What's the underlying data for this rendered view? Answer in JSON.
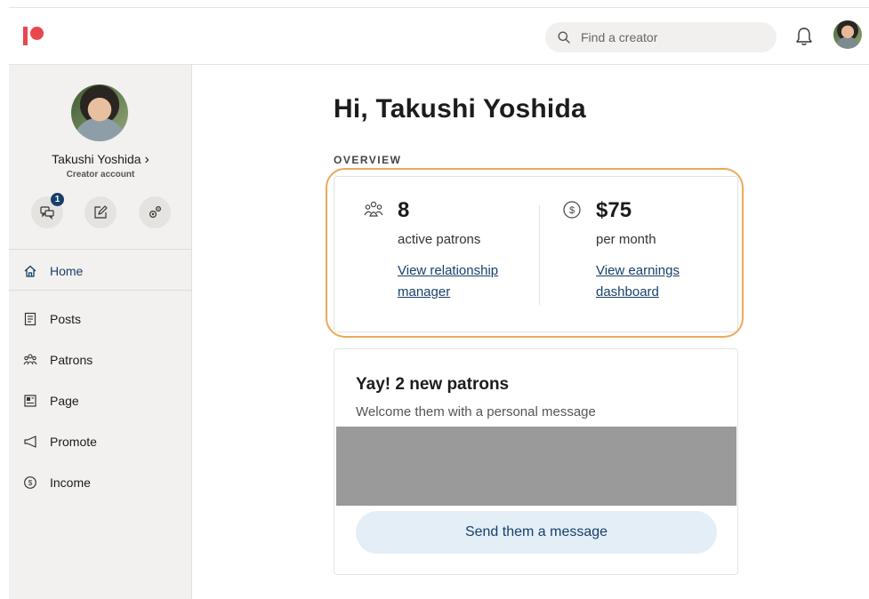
{
  "header": {
    "search_placeholder": "Find a creator"
  },
  "sidebar": {
    "profile_name": "Takushi Yoshida",
    "profile_chevron": "›",
    "profile_sub": "Creator account",
    "messages_badge": "1",
    "nav": [
      {
        "label": "Home",
        "icon": "home-icon",
        "active": true
      },
      {
        "label": "Posts",
        "icon": "posts-icon"
      },
      {
        "label": "Patrons",
        "icon": "patrons-icon"
      },
      {
        "label": "Page",
        "icon": "page-icon"
      },
      {
        "label": "Promote",
        "icon": "megaphone-icon"
      },
      {
        "label": "Income",
        "icon": "dollar-circle-icon"
      }
    ]
  },
  "main": {
    "greeting": "Hi, Takushi Yoshida",
    "overview_label": "OVERVIEW",
    "stats": [
      {
        "value": "8",
        "caption": "active patrons",
        "link": "View relationship manager"
      },
      {
        "value": "$75",
        "caption": "per month",
        "link": "View earnings dashboard"
      }
    ],
    "new_patrons": {
      "title": "Yay! 2 new patrons",
      "subtitle": "Welcome them with a personal message",
      "button": "Send them a message"
    }
  },
  "colors": {
    "brand": "#e8474d",
    "link": "#173f6b",
    "highlight": "#eca85c",
    "button_bg": "#e3eef7"
  }
}
